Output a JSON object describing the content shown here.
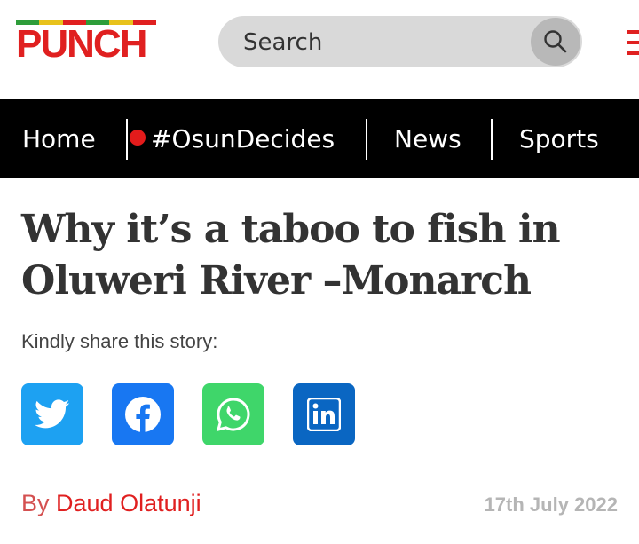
{
  "header": {
    "logo_text": "PUNCH",
    "logo_stripe_colors": [
      "#2e9d3a",
      "#e8c21c",
      "#e02020",
      "#2e9d3a",
      "#e8c21c",
      "#e02020"
    ],
    "search": {
      "placeholder": "Search",
      "value": ""
    },
    "search_icon": "search-icon",
    "menu_icon": "hamburger-menu-icon"
  },
  "nav": {
    "items": [
      {
        "label": "Home"
      },
      {
        "label": "#OsunDecides",
        "live": true
      },
      {
        "label": "News"
      },
      {
        "label": "Sports"
      }
    ]
  },
  "article": {
    "headline": "Why it’s a taboo to fish in Oluweri River –Monarch",
    "share_label": "Kindly share this story:",
    "share_buttons": [
      {
        "name": "twitter",
        "icon": "twitter-icon",
        "color": "#1da1f2"
      },
      {
        "name": "facebook",
        "icon": "facebook-icon",
        "color": "#1877f2"
      },
      {
        "name": "whatsapp",
        "icon": "whatsapp-icon",
        "color": "#25d366"
      },
      {
        "name": "linkedin",
        "icon": "linkedin-icon",
        "color": "#0a66c2"
      }
    ],
    "byline_prefix": "By",
    "author": "Daud Olatunji",
    "date": "17th July 2022"
  },
  "colors": {
    "brand_red": "#e02020",
    "nav_bg": "#000000",
    "date_gray": "#b5b5b5"
  }
}
